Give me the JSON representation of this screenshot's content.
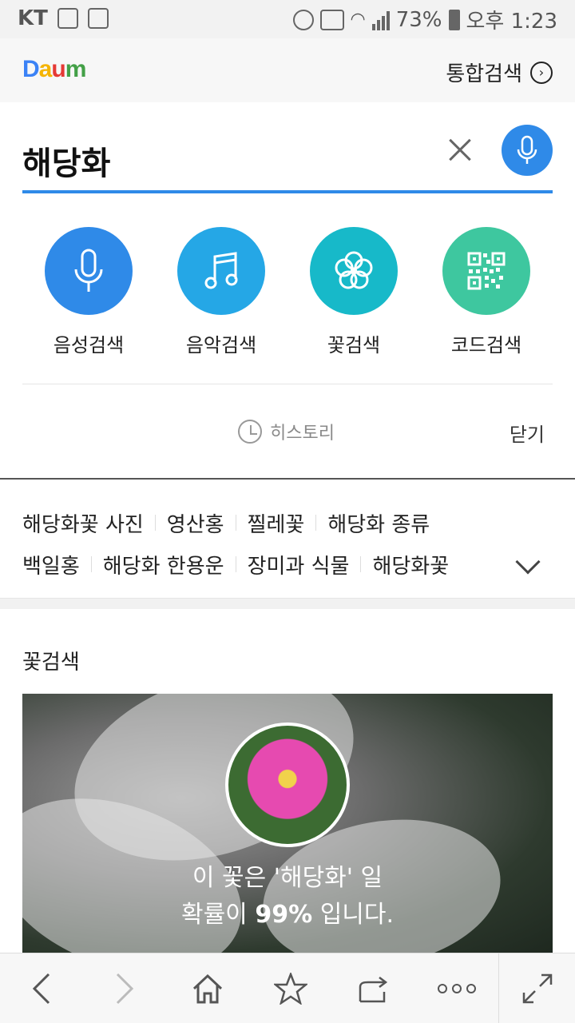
{
  "status_bar": {
    "carrier": "KT",
    "battery": "73%",
    "time": "오후 1:23"
  },
  "header": {
    "logo": "Daum",
    "unified_search": "통합검색"
  },
  "search": {
    "query": "해당화"
  },
  "functions": [
    {
      "label": "음성검색",
      "color": "#2f8ae8",
      "icon": "mic-icon"
    },
    {
      "label": "음악검색",
      "color": "#25a7e6",
      "icon": "music-note-icon"
    },
    {
      "label": "꽃검색",
      "color": "#17b9c9",
      "icon": "flower-icon"
    },
    {
      "label": "코드검색",
      "color": "#3ec79f",
      "icon": "qr-code-icon"
    }
  ],
  "history": {
    "label": "히스토리",
    "close": "닫기"
  },
  "related_keywords": {
    "row1": [
      "해당화꽃 사진",
      "영산홍",
      "찔레꽃",
      "해당화 종류"
    ],
    "row2": [
      "백일홍",
      "해당화 한용운",
      "장미과 식물",
      "해당화꽃"
    ]
  },
  "flower_search": {
    "title": "꽃검색",
    "result_line1": "이 꽃은 '해당화' 일",
    "result_prefix": "확률이",
    "result_value": "99%",
    "result_suffix": "입니다."
  },
  "bottom_bar": [
    "back-icon",
    "forward-icon",
    "home-icon",
    "bookmark-star-icon",
    "share-icon",
    "more-icon",
    "fullscreen-icon"
  ]
}
